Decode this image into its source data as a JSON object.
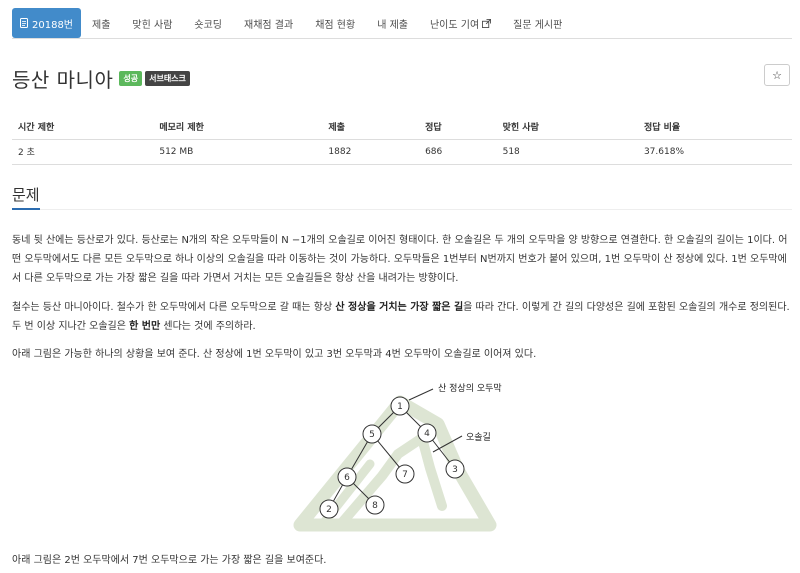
{
  "nav": {
    "tabs": [
      {
        "label": "20188번",
        "active": true
      },
      {
        "label": "제출"
      },
      {
        "label": "맞힌 사람"
      },
      {
        "label": "숏코딩"
      },
      {
        "label": "재채점 결과"
      },
      {
        "label": "채점 현황"
      },
      {
        "label": "내 제출"
      },
      {
        "label": "난이도 기여"
      },
      {
        "label": "질문 게시판"
      }
    ]
  },
  "problem": {
    "title": "등산 마니아",
    "badges": [
      "성공",
      "서브태스크"
    ],
    "star": "☆"
  },
  "info": {
    "headers": [
      "시간 제한",
      "메모리 제한",
      "제출",
      "정답",
      "맞힌 사람",
      "정답 비율"
    ],
    "values": [
      "2 초",
      "512 MB",
      "1882",
      "686",
      "518",
      "37.618%"
    ]
  },
  "section": {
    "title": "문제"
  },
  "paragraphs": {
    "p1": "동네 뒷 산에는 등산로가 있다. 등산로는 N개의 작은 오두막들이 N −1개의 오솔길로 이어진 형태이다. 한 오솔길은 두 개의 오두막을 양 방향으로 연결한다. 한 오솔길의 길이는 1이다. 어떤 오두막에서도 다른 모든 오두막으로 하나 이상의 오솔길을 따라 이동하는 것이 가능하다. 오두막들은 1번부터 N번까지 번호가 붙어 있으며, 1번 오두막이 산 정상에 있다. 1번 오두막에서 다른 오두막으로 가는 가장 짧은 길을 따라 가면서 거치는 모든 오솔길들은 항상 산을 내려가는 방향이다.",
    "p2_a": "철수는 등산 마니아이다. 철수가 한 오두막에서 다른 오두막으로 갈 때는 항상 ",
    "p2_b": "산 정상을 거치는 가장 짧은 길",
    "p2_c": "을 따라 간다. 이렇게 간 길의 다양성은 길에 포함된 오솔길의 개수로 정의된다. 두 번 이상 지나간 오솔길은 ",
    "p2_d": "한 번만",
    "p2_e": " 센다는 것에 주의하라.",
    "p3": "아래 그림은 가능한 하나의 상황을 보여 준다. 산 정상에 1번 오두막이 있고 3번 오두막과 4번 오두막이 오솔길로 이어져 있다.",
    "p4": "아래 그림은 2번 오두막에서 7번 오두막으로 가는 가장 짧은 길을 보여준다."
  },
  "figure": {
    "label_peak": "산 정상의 오두막",
    "label_path": "오솔길",
    "nodes": [
      "1",
      "5",
      "4",
      "6",
      "7",
      "3",
      "2",
      "8"
    ]
  },
  "colors": {
    "accent": "#428bca",
    "success": "#5cb85c",
    "mountain": "#dde5d3"
  }
}
